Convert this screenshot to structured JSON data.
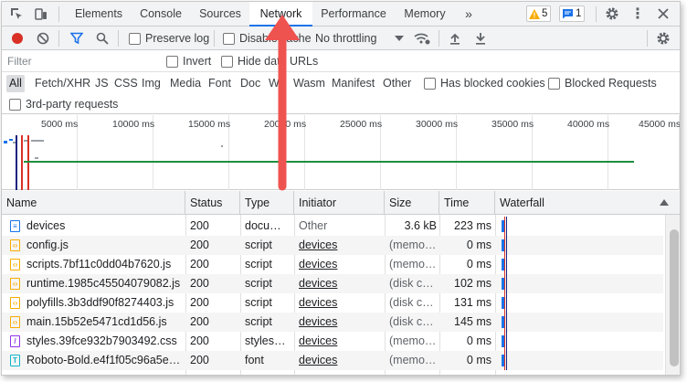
{
  "tabs": {
    "items": [
      "Elements",
      "Console",
      "Sources",
      "Network",
      "Performance",
      "Memory"
    ],
    "active": "Network",
    "more": "»",
    "warnings_count": "5",
    "messages_count": "1"
  },
  "toolbar": {
    "preserve_log": "Preserve log",
    "disable_cache": "Disable cache",
    "throttling": "No throttling"
  },
  "filter": {
    "placeholder": "Filter",
    "invert": "Invert",
    "hide_data_urls": "Hide data URLs"
  },
  "types": {
    "items": [
      "All",
      "Fetch/XHR",
      "JS",
      "CSS",
      "Img",
      "Media",
      "Font",
      "Doc",
      "WS",
      "Wasm",
      "Manifest",
      "Other"
    ],
    "blocked_cookies": "Has blocked cookies",
    "blocked_requests": "Blocked Requests",
    "third_party": "3rd-party requests"
  },
  "timeline": {
    "ticks": [
      "5000 ms",
      "10000 ms",
      "15000 ms",
      "20000 ms",
      "25000 ms",
      "30000 ms",
      "35000 ms",
      "40000 ms",
      "45000 ms"
    ]
  },
  "table": {
    "columns": [
      "Name",
      "Status",
      "Type",
      "Initiator",
      "Size",
      "Time",
      "Waterfall"
    ],
    "rows": [
      {
        "name": "devices",
        "status": "200",
        "type": "docum…",
        "initiator": "Other",
        "size": "3.6 kB",
        "time": "223 ms",
        "kind": "doc"
      },
      {
        "name": "config.js",
        "status": "200",
        "type": "script",
        "initiator": "devices",
        "size": "(memo…",
        "time": "0 ms",
        "kind": "js"
      },
      {
        "name": "scripts.7bf11c0dd04b7620.js",
        "status": "200",
        "type": "script",
        "initiator": "devices",
        "size": "(memo…",
        "time": "0 ms",
        "kind": "js"
      },
      {
        "name": "runtime.1985c45504079082.js",
        "status": "200",
        "type": "script",
        "initiator": "devices",
        "size": "(disk ca…",
        "time": "102 ms",
        "kind": "js"
      },
      {
        "name": "polyfills.3b3ddf90f8274403.js",
        "status": "200",
        "type": "script",
        "initiator": "devices",
        "size": "(disk ca…",
        "time": "131 ms",
        "kind": "js"
      },
      {
        "name": "main.15b52e5471cd1d56.js",
        "status": "200",
        "type": "script",
        "initiator": "devices",
        "size": "(disk ca…",
        "time": "145 ms",
        "kind": "js"
      },
      {
        "name": "styles.39fce932b7903492.css",
        "status": "200",
        "type": "stylesh…",
        "initiator": "devices",
        "size": "(memo…",
        "time": "0 ms",
        "kind": "css"
      },
      {
        "name": "Roboto-Bold.e4f1f05c96a5e5e…",
        "status": "200",
        "type": "font",
        "initiator": "devices",
        "size": "(memo…",
        "time": "0 ms",
        "kind": "font"
      }
    ]
  },
  "colors": {
    "accent": "#1a73e8",
    "record": "#d93025",
    "annotation": "#ef5350",
    "timeline_green": "#1e8e3e"
  },
  "icons": [
    "inspect-icon",
    "device-toggle-icon",
    "more-tabs-icon",
    "warning-icon",
    "message-icon",
    "gear-icon",
    "close-icon",
    "record-icon",
    "clear-icon",
    "filter-icon",
    "search-icon",
    "throttle-dropdown-icon",
    "network-conditions-icon",
    "import-icon",
    "export-icon",
    "settings-icon"
  ]
}
